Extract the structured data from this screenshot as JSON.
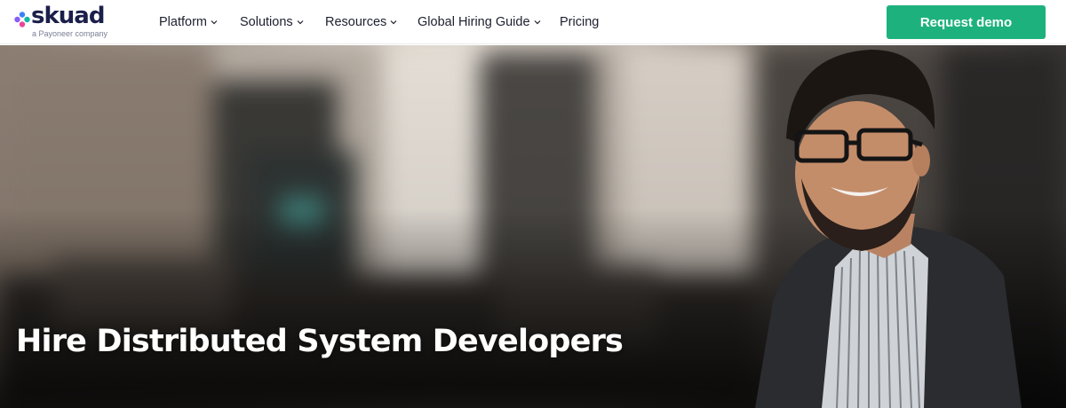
{
  "header": {
    "logo": {
      "wordmark": "skuad",
      "tagline": "a Payoneer company"
    },
    "nav": [
      {
        "label": "Platform",
        "has_dropdown": true,
        "icon": "chevron-down-icon"
      },
      {
        "label": "Solutions",
        "has_dropdown": true,
        "icon": "chevron-down-icon"
      },
      {
        "label": "Resources",
        "has_dropdown": true,
        "icon": "chevron-down-icon"
      },
      {
        "label": "Global Hiring Guide",
        "has_dropdown": true,
        "icon": "chevron-down-icon"
      },
      {
        "label": "Pricing",
        "has_dropdown": false
      }
    ],
    "cta_label": "Request demo"
  },
  "hero": {
    "title": "Hire Distributed System Developers"
  },
  "colors": {
    "brand_navy": "#1b1f4a",
    "cta_green": "#1db27d",
    "logo_dot_blue": "#3b82f6",
    "logo_dot_purple": "#8b5cf6",
    "logo_dot_pink": "#ec4899",
    "logo_dot_teal": "#14b8a6"
  }
}
